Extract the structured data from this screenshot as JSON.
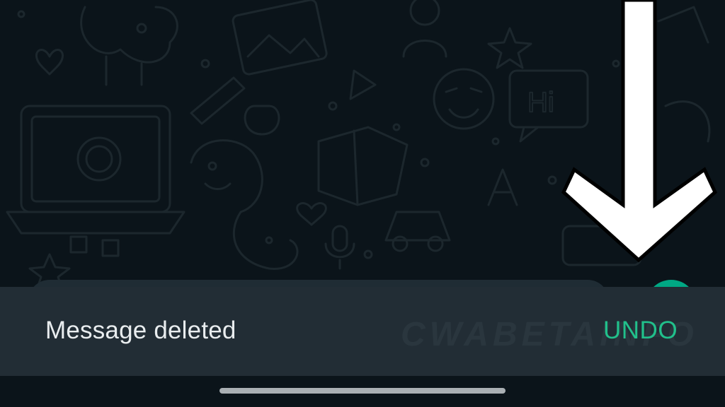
{
  "snackbar": {
    "message": "Message deleted",
    "action_label": "UNDO",
    "watermark_text": "CWABETAINFO",
    "action_color": "#21c08b"
  },
  "doodle_hi_text": "Hi",
  "icons": {
    "arrow": "arrow-down-icon",
    "send": "send-icon"
  },
  "colors": {
    "background": "#0b141a",
    "snackbar": "#222d35",
    "accent": "#00a884"
  }
}
